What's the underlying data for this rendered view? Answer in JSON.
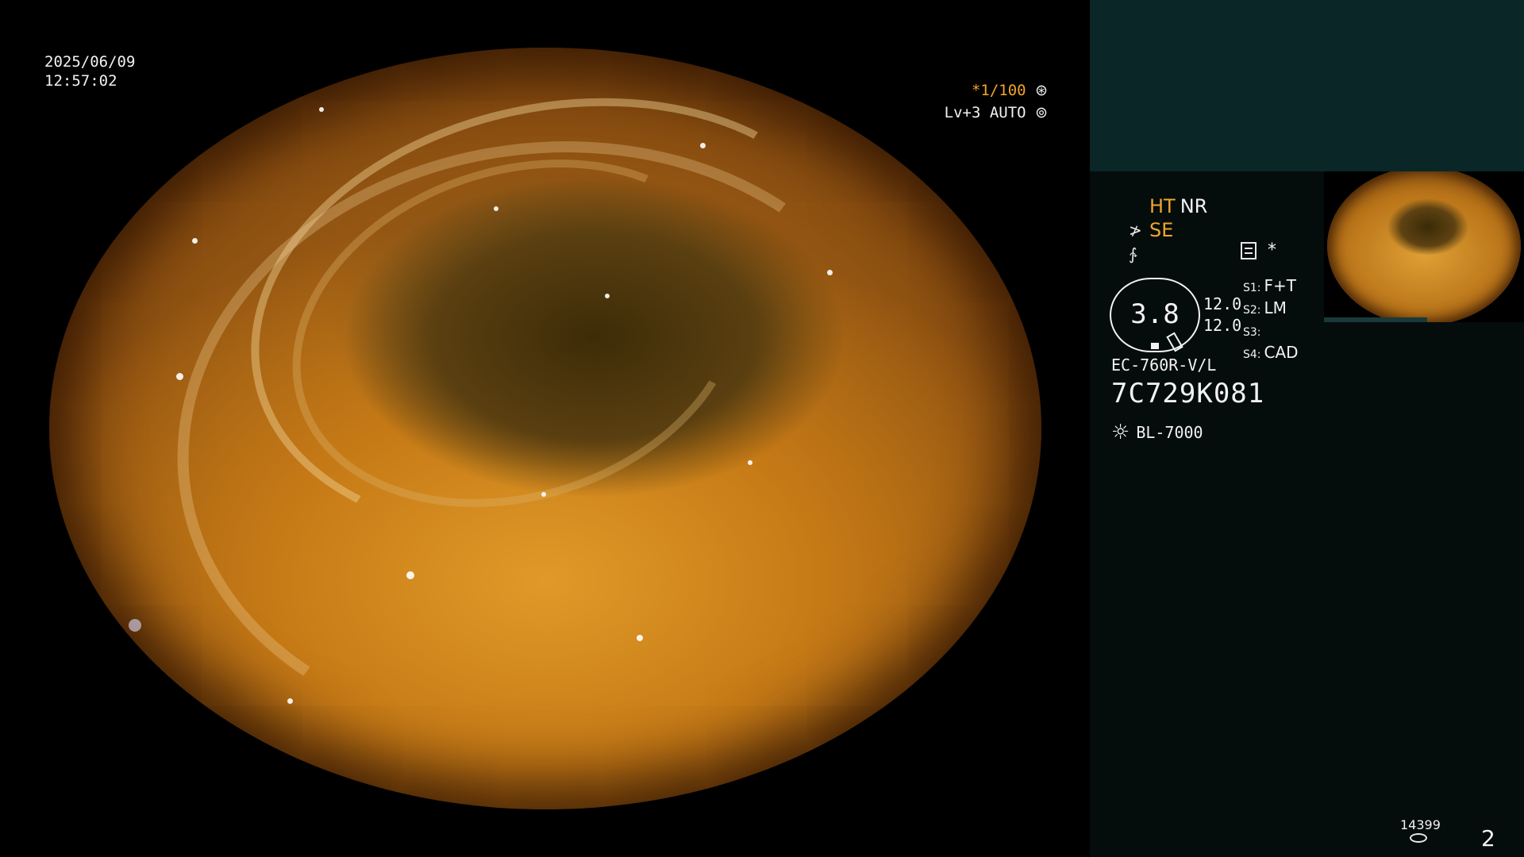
{
  "overlay": {
    "date": "2025/06/09",
    "time": "12:57:02",
    "shutter": "*1/100",
    "shutter_icon": "aperture-icon",
    "level": "Lv+3 AUTO",
    "level_icon": "iris-icon"
  },
  "panel": {
    "mode1": "HT",
    "mode2": "NR",
    "mode3": "SE",
    "mode_icon": "scope-icon",
    "mode_icon2": "freeze-icon",
    "star": "*",
    "gauge_value": "3.8",
    "gauge_num1": "12.0",
    "gauge_num2": "12.0",
    "slots": [
      {
        "key": "S1:",
        "value": "F+T"
      },
      {
        "key": "S2:",
        "value": "LM"
      },
      {
        "key": "S3:",
        "value": ""
      },
      {
        "key": "S4:",
        "value": "CAD"
      }
    ],
    "scope_model": "EC-760R-V/L",
    "serial": "7C729K081",
    "light_source": "BL-7000",
    "counter": "14399",
    "page": "2"
  },
  "colors": {
    "accent": "#f0a52a",
    "panel_top": "#0a2626",
    "panel_bg": "#050c0c"
  }
}
